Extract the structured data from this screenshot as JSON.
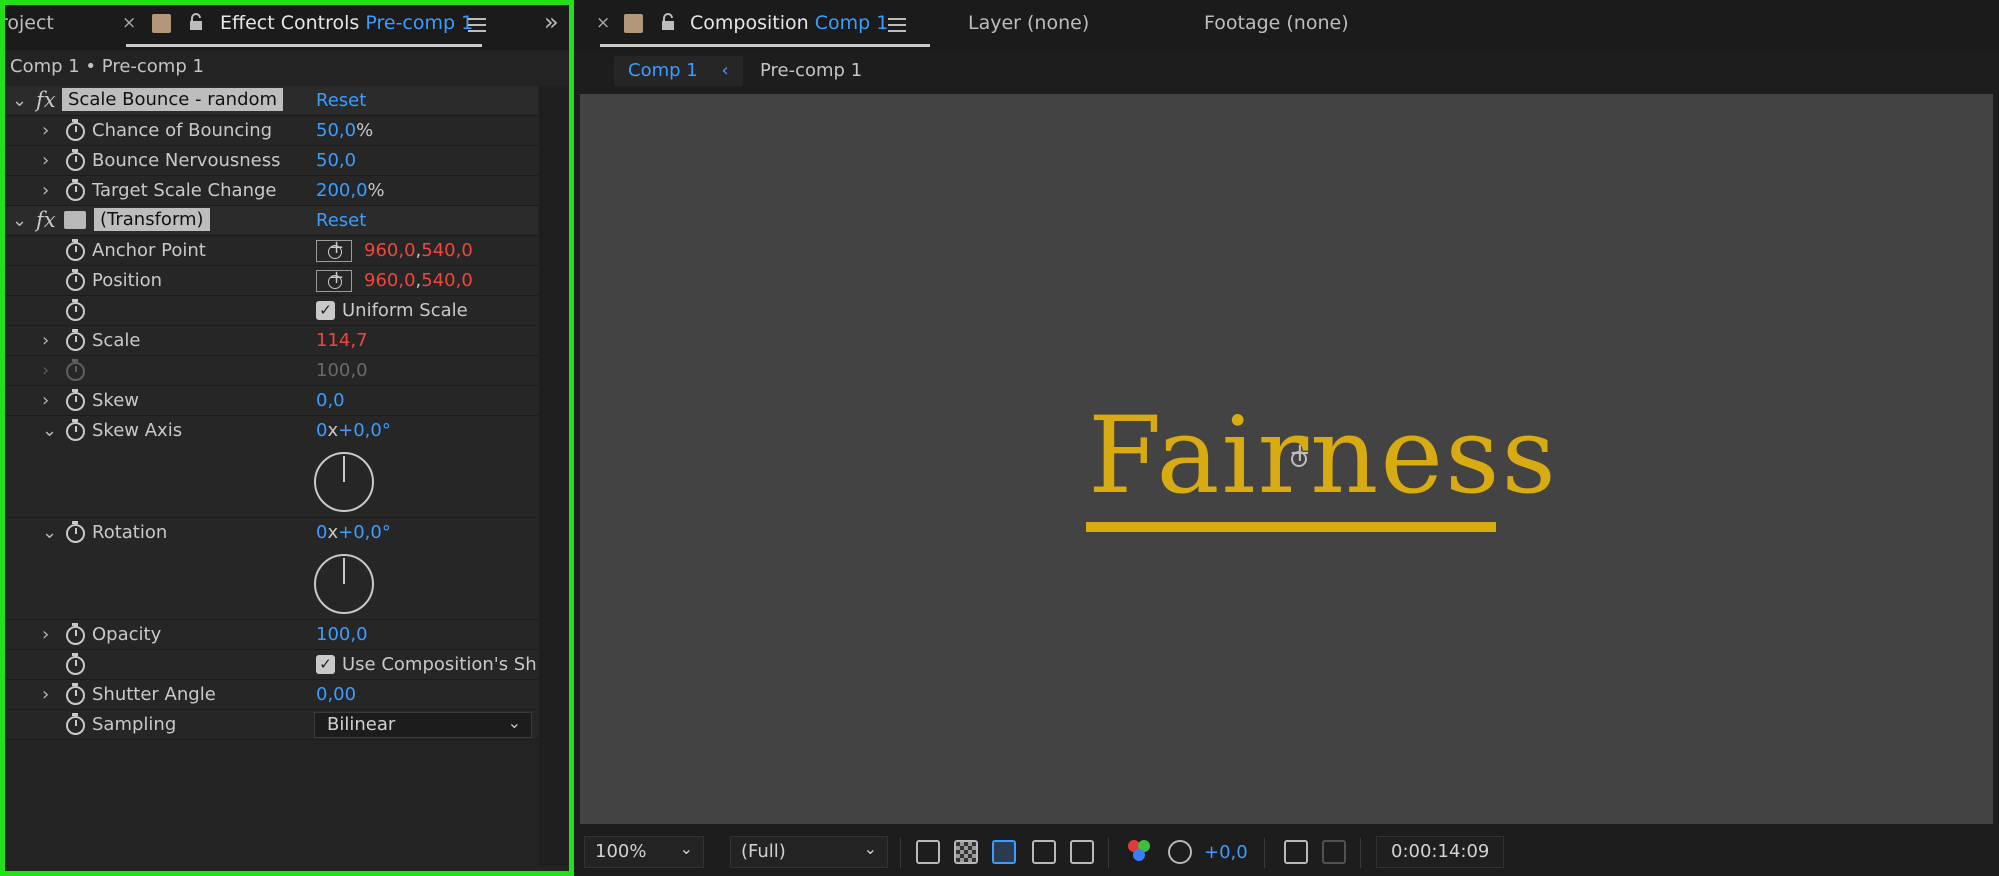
{
  "left_panel": {
    "tabs": {
      "project_partial": "roject",
      "effect_controls_label": "Effect Controls",
      "effect_controls_layer": "Pre-comp 1"
    },
    "breadcrumb": "Comp 1 • Pre-comp 1",
    "effects": [
      {
        "name": "Scale Bounce - random",
        "reset": "Reset",
        "params": [
          {
            "name": "Chance of Bouncing",
            "value": "50,0",
            "unit": "%"
          },
          {
            "name": "Bounce Nervousness",
            "value": "50,0",
            "unit": ""
          },
          {
            "name": "Target Scale Change",
            "value": "200,0",
            "unit": "%"
          }
        ]
      },
      {
        "name": "(Transform)",
        "reset": "Reset",
        "params": {
          "anchor_point": {
            "name": "Anchor Point",
            "x": "960,0",
            "y": "540,0"
          },
          "position": {
            "name": "Position",
            "x": "960,0",
            "y": "540,0"
          },
          "uniform_scale": {
            "label": "Uniform Scale",
            "checked": true
          },
          "scale": {
            "name": "Scale",
            "value": "114,7"
          },
          "scale_height": {
            "value": "100,0"
          },
          "skew": {
            "name": "Skew",
            "value": "0,0"
          },
          "skew_axis": {
            "name": "Skew Axis",
            "revolutions": "0",
            "degrees": "+0,0°"
          },
          "rotation": {
            "name": "Rotation",
            "revolutions": "0",
            "degrees": "+0,0°"
          },
          "opacity": {
            "name": "Opacity",
            "value": "100,0"
          },
          "use_comp_shutter": {
            "label": "Use Composition's Sh",
            "checked": true
          },
          "shutter_angle": {
            "name": "Shutter Angle",
            "value": "0,00"
          },
          "sampling": {
            "name": "Sampling",
            "value": "Bilinear"
          }
        }
      }
    ]
  },
  "right_panel": {
    "tabs": {
      "composition_label": "Composition",
      "composition_name": "Comp 1",
      "layer": "Layer (none)",
      "footage": "Footage (none)"
    },
    "subtabs": [
      "Comp 1",
      "Pre-comp 1"
    ],
    "canvas_text": "Fairness",
    "bottom": {
      "zoom": "100%",
      "resolution": "(Full)",
      "exposure": "+0,0",
      "timecode": "0:00:14:09"
    }
  },
  "colors": {
    "accent_blue": "#3c9dff",
    "keyframed_red": "#f0463c",
    "highlight_green": "#23e01b",
    "text_gold": "#d8ab12"
  }
}
